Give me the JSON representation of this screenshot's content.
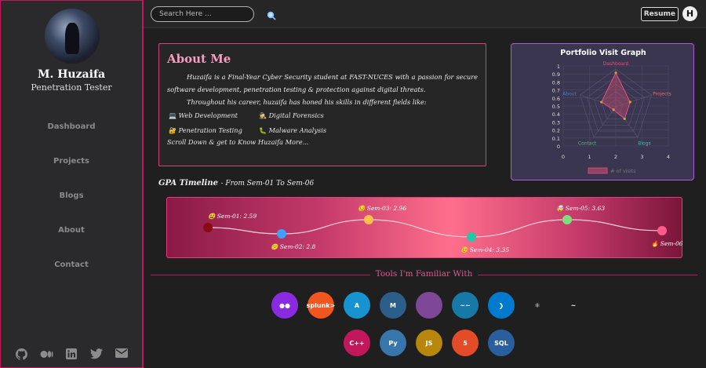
{
  "profile": {
    "name": "M. Huzaifa",
    "role": "Penetration Tester"
  },
  "nav": [
    "Dashboard",
    "Projects",
    "Blogs",
    "About",
    "Contact"
  ],
  "socials": [
    "github-icon",
    "medium-icon",
    "linkedin-icon",
    "twitter-icon",
    "email-icon"
  ],
  "topbar": {
    "search_placeholder": "Search Here ...",
    "resume_label": "Resume",
    "profile_initial": "H"
  },
  "about": {
    "title": "About Me",
    "para1": "Huzaifa is a Final-Year Cyber Security student at FAST-NUCES with a passion for secure software development, penetration testing & protection against digital threats.",
    "para2": "Throughout his career, huzaifa has honed his skills in different fields like:",
    "skills": [
      {
        "icon": "laptop-icon",
        "label": "Web Development"
      },
      {
        "icon": "detective-icon",
        "label": "Digital Forensics"
      },
      {
        "icon": "lock-icon",
        "label": "Penetration Testing"
      },
      {
        "icon": "bug-icon",
        "label": "Malware Analysis"
      }
    ],
    "scroll_note": "Scroll Down & get to Know Huzaifa More..."
  },
  "chart_data": {
    "type": "radar",
    "title": "Portfolio Visit Graph",
    "categories": [
      "Dashboard",
      "Projects",
      "Blogs",
      "Contact",
      "About"
    ],
    "series": [
      {
        "name": "# of visits",
        "values": [
          0.9,
          0.4,
          0.4,
          0.1,
          0.4
        ]
      }
    ],
    "ylim": [
      0,
      1
    ],
    "ticks_y": [
      "1",
      "0.9",
      "0.8",
      "0.7",
      "0.6",
      "0.5",
      "0.4",
      "0.3",
      "0.2",
      "0.1",
      "0"
    ],
    "ticks_x": [
      "0",
      "1",
      "2",
      "3",
      "4"
    ],
    "legend": "bottom",
    "colors": {
      "Dashboard": "#e0507a",
      "Projects": "#e0707a",
      "Blogs": "#3cc0a0",
      "Contact": "#40c070",
      "About": "#4080d0"
    }
  },
  "gpa": {
    "title": "GPA Timeline",
    "subtitle": "- From Sem-01 To Sem-06",
    "points": [
      {
        "label": "Sem-01: 2.59",
        "emoji": "😫",
        "color": "#8b0a14"
      },
      {
        "label": "Sem-02: 2.8",
        "emoji": "😕",
        "color": "#3fa0ff"
      },
      {
        "label": "Sem-03: 2.96",
        "emoji": "😏",
        "color": "#ffc04d"
      },
      {
        "label": "Sem-04: 3.35",
        "emoji": "😊",
        "color": "#21c9a6"
      },
      {
        "label": "Sem-05: 3.63",
        "emoji": "🤯",
        "color": "#7ce07a"
      },
      {
        "label": "Sem-06:",
        "emoji": "🔥",
        "color": "#ff5c8d"
      }
    ]
  },
  "tools": {
    "title": "Tools I'm Familiar With",
    "row1": [
      {
        "icon": "medium-logo-icon",
        "text": "●●",
        "bg": "#8a2be2"
      },
      {
        "icon": "splunk-icon",
        "text": "splunk>",
        "bg": "#f0561d"
      },
      {
        "icon": "arch-linux-icon",
        "text": "A",
        "bg": "#1793d1"
      },
      {
        "icon": "metasploit-icon",
        "text": "M",
        "bg": "#2b5f8a"
      },
      {
        "icon": "tor-icon",
        "text": "",
        "bg": "#7e4798"
      },
      {
        "icon": "wireshark-icon",
        "text": "~~",
        "bg": "#1679a7"
      },
      {
        "icon": "vscode-icon",
        "text": "❯",
        "bg": "#007acc"
      },
      {
        "icon": "react-icon",
        "text": "⚛",
        "bg": "#1f1f1f"
      },
      {
        "icon": "kali-linux-icon",
        "text": "~",
        "bg": "#1f1f1f"
      }
    ],
    "row2": [
      {
        "icon": "cpp-icon",
        "text": "C++",
        "bg": "#c2185b"
      },
      {
        "icon": "python-icon",
        "text": "Py",
        "bg": "#3776ab"
      },
      {
        "icon": "javascript-icon",
        "text": "JS",
        "bg": "#b8860b"
      },
      {
        "icon": "html5-icon",
        "text": "5",
        "bg": "#e34c26"
      },
      {
        "icon": "sql-icon",
        "text": "SQL",
        "bg": "#2a5f9e"
      }
    ]
  }
}
